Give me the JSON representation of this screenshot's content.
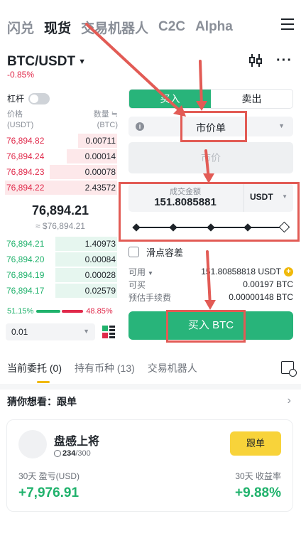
{
  "topnav": {
    "tabs": [
      "闪兑",
      "现货",
      "交易机器人",
      "C2C",
      "Alpha"
    ],
    "active_index": 1
  },
  "pair": {
    "symbol": "BTC/USDT",
    "change": "-0.85%"
  },
  "leverage": {
    "label": "杠杆"
  },
  "orderbook": {
    "price_label": "价格",
    "price_unit": "(USDT)",
    "qty_label": "数量 ≒",
    "qty_unit": "(BTC)",
    "asks": [
      {
        "price": "76,894.82",
        "qty": "0.00711",
        "depth": 0.35
      },
      {
        "price": "76,894.24",
        "qty": "0.00014",
        "depth": 0.45
      },
      {
        "price": "76,894.23",
        "qty": "0.00078",
        "depth": 0.6
      },
      {
        "price": "76,894.22",
        "qty": "2.43572",
        "depth": 1.0
      }
    ],
    "mid_price": "76,894.21",
    "mid_usd": "≈ $76,894.21",
    "bids": [
      {
        "price": "76,894.21",
        "qty": "1.40973",
        "depth": 0.55
      },
      {
        "price": "76,894.20",
        "qty": "0.00084",
        "depth": 0.55
      },
      {
        "price": "76,894.19",
        "qty": "0.00028",
        "depth": 0.55
      },
      {
        "price": "76,894.17",
        "qty": "0.02579",
        "depth": 0.55
      }
    ],
    "buy_ratio": "51.15%",
    "sell_ratio": "48.85%",
    "precision": "0.01"
  },
  "trade": {
    "buy_tab": "买入",
    "sell_tab": "卖出",
    "order_type": "市价单",
    "market_placeholder": "市价",
    "amount_label": "成交金额",
    "amount_value": "151.8085881",
    "amount_unit": "USDT",
    "slippage_label": "滑点容差",
    "available_label": "可用",
    "available_value": "151.80858818 USDT",
    "can_buy_label": "可买",
    "can_buy_value": "0.00197 BTC",
    "fee_label": "预估手续费",
    "fee_value": "0.00000148 BTC",
    "buy_button": "买入 BTC",
    "slider_percent": 100
  },
  "bottom_tabs": {
    "tabs": [
      "当前委托 (0)",
      "持有币种 (13)",
      "交易机器人"
    ]
  },
  "guess": {
    "title": "猜你想看：跟单"
  },
  "copy_card": {
    "name": "盘感上将",
    "followers_current": "234",
    "followers_total": "/300",
    "follow_button": "跟单",
    "pnl_label": "30天 盈亏(USD)",
    "pnl_value": "+7,976.91",
    "roi_label": "30天 收益率",
    "roi_value": "+9.88%"
  },
  "colors": {
    "buy": "#28b47a",
    "sell": "#e0294a",
    "accent": "#f0b90b",
    "annotation": "#e25b55"
  }
}
